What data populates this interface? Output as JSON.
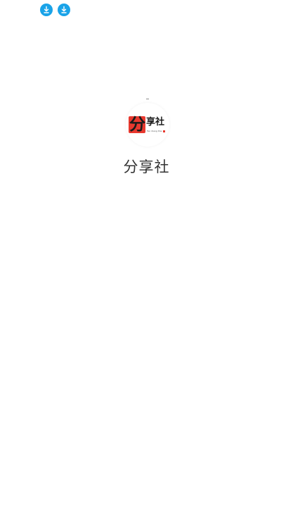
{
  "status_bar": {
    "icons": [
      {
        "name": "download-icon",
        "color": "#1aa3e8"
      },
      {
        "name": "download-icon",
        "color": "#1aa3e8"
      }
    ]
  },
  "splash": {
    "logo": {
      "seal_char": "分",
      "side_chars": "享社",
      "pinyin": "Fen Xiang She",
      "seal_color": "#e8392f"
    },
    "app_name": "分享社"
  }
}
